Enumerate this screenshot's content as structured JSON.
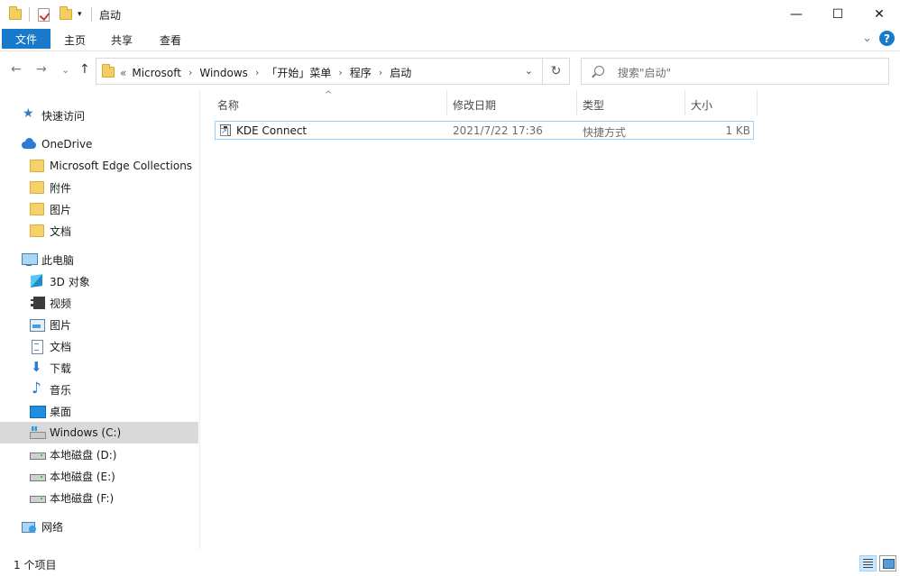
{
  "window": {
    "title": "启动",
    "minimize_glyph": "—",
    "maximize_glyph": "☐",
    "close_glyph": "✕"
  },
  "ribbon": {
    "tabs": [
      {
        "label": "文件"
      },
      {
        "label": "主页"
      },
      {
        "label": "共享"
      },
      {
        "label": "查看"
      }
    ],
    "expand_glyph": "⌄",
    "help_glyph": "?"
  },
  "address": {
    "overflow": "«",
    "crumbs": [
      "Microsoft",
      "Windows",
      "「开始」菜单",
      "程序",
      "启动"
    ],
    "chevron": "›",
    "dropdown_glyph": "⌄",
    "refresh_glyph": "↻"
  },
  "search": {
    "placeholder": "搜索\"启动\""
  },
  "nav": {
    "back": "←",
    "forward": "→",
    "recent": "⌄",
    "up": "↑"
  },
  "sidebar": {
    "items": [
      {
        "label": "快速访问",
        "icon": "star-icon"
      },
      {
        "label": "OneDrive",
        "icon": "cloud-icon"
      },
      {
        "label": "Microsoft Edge Collections",
        "icon": "folder-icon"
      },
      {
        "label": "附件",
        "icon": "folder-icon"
      },
      {
        "label": "图片",
        "icon": "folder-icon"
      },
      {
        "label": "文档",
        "icon": "folder-icon"
      },
      {
        "label": "此电脑",
        "icon": "computer-icon"
      },
      {
        "label": "3D 对象",
        "icon": "cube-icon"
      },
      {
        "label": "视频",
        "icon": "video-icon"
      },
      {
        "label": "图片",
        "icon": "picture-icon"
      },
      {
        "label": "文档",
        "icon": "document-icon"
      },
      {
        "label": "下载",
        "icon": "download-icon"
      },
      {
        "label": "音乐",
        "icon": "music-icon"
      },
      {
        "label": "桌面",
        "icon": "desktop-icon"
      },
      {
        "label": "Windows (C:)",
        "icon": "windows-drive-icon",
        "selected": true
      },
      {
        "label": "本地磁盘 (D:)",
        "icon": "drive-icon"
      },
      {
        "label": "本地磁盘 (E:)",
        "icon": "drive-icon"
      },
      {
        "label": "本地磁盘 (F:)",
        "icon": "drive-icon"
      },
      {
        "label": "网络",
        "icon": "network-icon"
      }
    ]
  },
  "list": {
    "sort_indicator": "^",
    "columns": [
      "名称",
      "修改日期",
      "类型",
      "大小"
    ],
    "rows": [
      {
        "name": "KDE Connect",
        "date": "2021/7/22 17:36",
        "type": "快捷方式",
        "size": "1 KB",
        "icon": "shortcut-icon"
      }
    ]
  },
  "status": {
    "item_count": "1 个项目"
  },
  "colors": {
    "accent": "#1979ca",
    "selection": "#cce8ff",
    "selection_border": "#99d1ff"
  }
}
